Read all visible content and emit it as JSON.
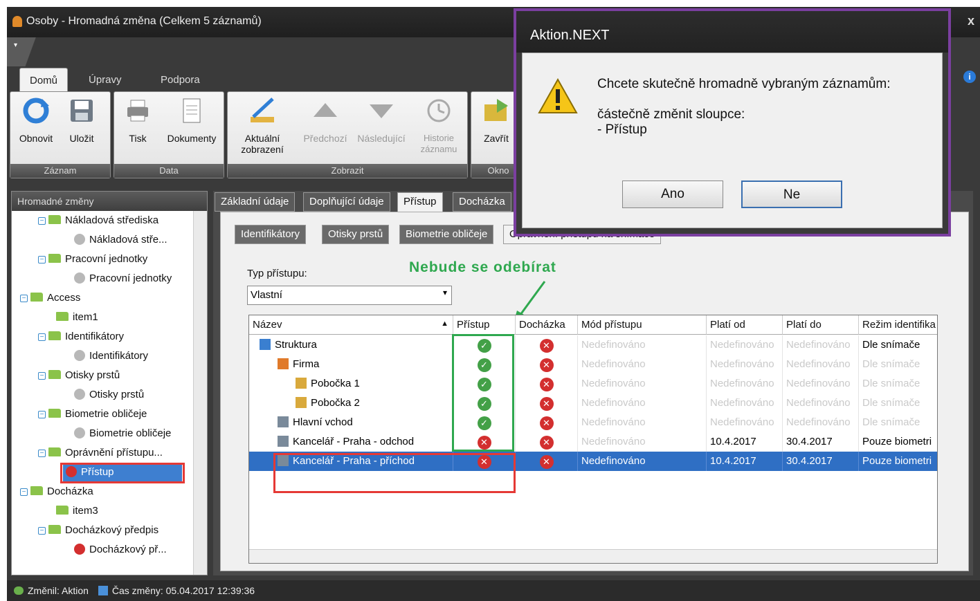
{
  "window": {
    "title": "Osoby - Hromadná změna (Celkem 5 záznamů)",
    "close": "x",
    "qat_label": "▾"
  },
  "ribbon_tabs": [
    "Domů",
    "Úpravy",
    "Podpora"
  ],
  "info_label": "i",
  "ribbon": {
    "groups": [
      {
        "label": "Záznam"
      },
      {
        "label": "Data"
      },
      {
        "label": "Zobrazit"
      },
      {
        "label": "Okno"
      }
    ],
    "buttons": {
      "obnovit": "Obnovit",
      "ulozit": "Uložit",
      "tisk": "Tisk",
      "dokumenty": "Dokumenty",
      "aktualni": "Aktuální zobrazení",
      "predchozi": "Předchozí",
      "nasledujici": "Následující",
      "historie": "Historie záznamu",
      "zavrit": "Zavřít"
    }
  },
  "left_panel": {
    "header": "Hromadné změny",
    "tree": [
      "Nákladová střediska",
      "Nákladová stře...",
      "Pracovní jednotky",
      "Pracovní jednotky",
      "Access",
      "item1",
      "Identifikátory",
      "Identifikátory",
      "Otisky prstů",
      "Otisky prstů",
      "Biometrie obličeje",
      "Biometrie obličeje",
      "Oprávnění přístupu...",
      "Přístup",
      "Docházka",
      "item3",
      "Docházkový předpis",
      "Docházkový př..."
    ]
  },
  "main_tabs": [
    "Základní údaje",
    "Doplňující údaje",
    "Přístup",
    "Docházka"
  ],
  "sub_tabs": [
    "Identifikátory",
    "Otisky prstů",
    "Biometrie obličeje",
    "Oprávnění přístupu na snímače"
  ],
  "typ_pristupu": {
    "label": "Typ přístupu:",
    "value": "Vlastní"
  },
  "annotation": "Nebude se odebírat",
  "grid": {
    "columns": [
      "Název",
      "Přístup",
      "Docházka",
      "Mód přístupu",
      "Platí od",
      "Platí do",
      "Režim identifika"
    ],
    "rows": [
      {
        "name": "Struktura",
        "pristup": "ok",
        "dochazka": "no",
        "mod": "Nedefinováno",
        "od": "Nedefinováno",
        "do": "Nedefinováno",
        "rezim": "Dle snímače"
      },
      {
        "name": "Firma",
        "pristup": "ok",
        "dochazka": "no",
        "mod": "Nedefinováno",
        "od": "Nedefinováno",
        "do": "Nedefinováno",
        "rezim": "Dle snímače"
      },
      {
        "name": "Pobočka 1",
        "pristup": "ok",
        "dochazka": "no",
        "mod": "Nedefinováno",
        "od": "Nedefinováno",
        "do": "Nedefinováno",
        "rezim": "Dle snímače"
      },
      {
        "name": "Pobočka 2",
        "pristup": "ok",
        "dochazka": "no",
        "mod": "Nedefinováno",
        "od": "Nedefinováno",
        "do": "Nedefinováno",
        "rezim": "Dle snímače"
      },
      {
        "name": "Hlavní vchod",
        "pristup": "ok",
        "dochazka": "no",
        "mod": "Nedefinováno",
        "od": "Nedefinováno",
        "do": "Nedefinováno",
        "rezim": "Dle snímače"
      },
      {
        "name": "Kancelář - Praha - odchod",
        "pristup": "no",
        "dochazka": "no",
        "mod": "Nedefinováno",
        "od": "10.4.2017",
        "do": "30.4.2017",
        "rezim": "Pouze biometri"
      },
      {
        "name": "Kancelář - Praha - příchod",
        "pristup": "no",
        "dochazka": "no",
        "mod": "Nedefinováno",
        "od": "10.4.2017",
        "do": "30.4.2017",
        "rezim": "Pouze biometri"
      }
    ]
  },
  "status": {
    "changed_by": "Změnil: Aktion",
    "changed_at": "Čas změny: 05.04.2017 12:39:36"
  },
  "dialog": {
    "title": "Aktion.NEXT",
    "line1": "Chcete skutečně hromadně vybraným záznamům:",
    "line2": "částečně změnit sloupce:",
    "line3": "- Přístup",
    "yes": "Ano",
    "no": "Ne"
  },
  "colors": {
    "highlight_red": "#e53935",
    "highlight_green": "#2fa84f",
    "dialog_border": "#7b3fa0",
    "selection": "#2f6fc4"
  }
}
